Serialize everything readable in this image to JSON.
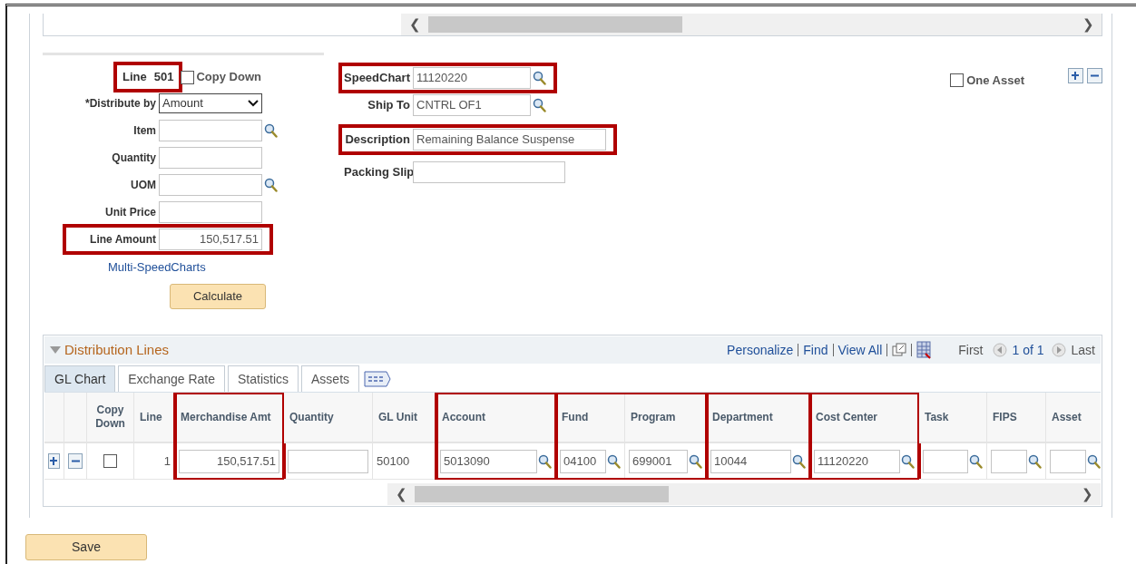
{
  "top_scrollbar": {
    "left": "❮",
    "right": "❯"
  },
  "line": {
    "label": "Line",
    "value": "501",
    "highlighted": true
  },
  "copy_down": {
    "label": "Copy Down",
    "checked": false
  },
  "left_fields": [
    {
      "label": "*Distribute by",
      "kind": "select",
      "value": "Amount",
      "lookup": false,
      "highlighted": false
    },
    {
      "label": "Item",
      "kind": "input",
      "lookup": true,
      "highlighted": false
    },
    {
      "label": "Quantity",
      "kind": "input",
      "lookup": false,
      "highlighted": false
    },
    {
      "label": "UOM",
      "kind": "input",
      "lookup": true,
      "highlighted": false
    },
    {
      "label": "Unit Price",
      "kind": "input",
      "lookup": false,
      "highlighted": false
    },
    {
      "label": "Line Amount",
      "kind": "amount",
      "value": "150,517.51",
      "lookup": false,
      "highlighted": true
    }
  ],
  "multi_speedcharts_link": "Multi-SpeedCharts",
  "calculate_button": "Calculate",
  "right_fields": [
    {
      "label": "SpeedChart",
      "kind": "short",
      "value": "11120220",
      "lookup": true,
      "highlighted": true
    },
    {
      "label": "Ship To",
      "kind": "short",
      "value": "CNTRL OF1",
      "lookup": true,
      "highlighted": false
    },
    {
      "label": "Description",
      "kind": "long",
      "value": "Remaining Balance Suspense",
      "lookup": false,
      "highlighted": true
    },
    {
      "label": "Packing Slip",
      "kind": "medium",
      "lookup": false,
      "highlighted": false
    }
  ],
  "one_asset": {
    "label": "One Asset",
    "checked": false
  },
  "distribution_lines": {
    "title": "Distribution Lines",
    "expanded": true,
    "links": [
      "Personalize",
      "Find",
      "View All"
    ],
    "nav": {
      "first": "First",
      "count": "1 of 1",
      "last": "Last"
    },
    "tabs": [
      {
        "label": "GL Chart",
        "selected": true
      },
      {
        "label": "Exchange Rate",
        "selected": false
      },
      {
        "label": "Statistics",
        "selected": false
      },
      {
        "label": "Assets",
        "selected": false
      }
    ],
    "column_groups": [
      {
        "highlighted": false,
        "columns": [
          {
            "kind": "add"
          },
          {
            "kind": "remove"
          },
          {
            "header": "Copy Down",
            "kind": "checkbox",
            "checked": false
          },
          {
            "header": "Line",
            "kind": "text",
            "value": "1"
          }
        ]
      },
      {
        "highlighted": true,
        "columns": [
          {
            "header": "Merchandise Amt",
            "kind": "amount",
            "value": "150,517.51",
            "lookup": false
          }
        ]
      },
      {
        "highlighted": false,
        "columns": [
          {
            "header": "Quantity",
            "kind": "input",
            "lookup": false
          },
          {
            "header": "GL Unit",
            "kind": "text",
            "value": "50100"
          }
        ]
      },
      {
        "highlighted": true,
        "columns": [
          {
            "header": "Account",
            "kind": "input",
            "value": "5013090",
            "lookup": true
          }
        ]
      },
      {
        "highlighted": true,
        "columns": [
          {
            "header": "Fund",
            "kind": "input",
            "value": "04100",
            "lookup": true
          },
          {
            "header": "Program",
            "kind": "input",
            "value": "699001",
            "lookup": true
          }
        ]
      },
      {
        "highlighted": true,
        "columns": [
          {
            "header": "Department",
            "kind": "input",
            "value": "10044",
            "lookup": true
          }
        ]
      },
      {
        "highlighted": true,
        "columns": [
          {
            "header": "Cost Center",
            "kind": "input",
            "value": "11120220",
            "lookup": true
          }
        ]
      },
      {
        "highlighted": false,
        "columns": [
          {
            "header": "Task",
            "kind": "input",
            "lookup": true
          },
          {
            "header": "FIPS",
            "kind": "input",
            "lookup": true
          },
          {
            "header": "Asset",
            "kind": "input",
            "lookup": true
          }
        ]
      }
    ],
    "scroll": {
      "left": "❮",
      "right": "❯"
    }
  },
  "save_button": "Save"
}
